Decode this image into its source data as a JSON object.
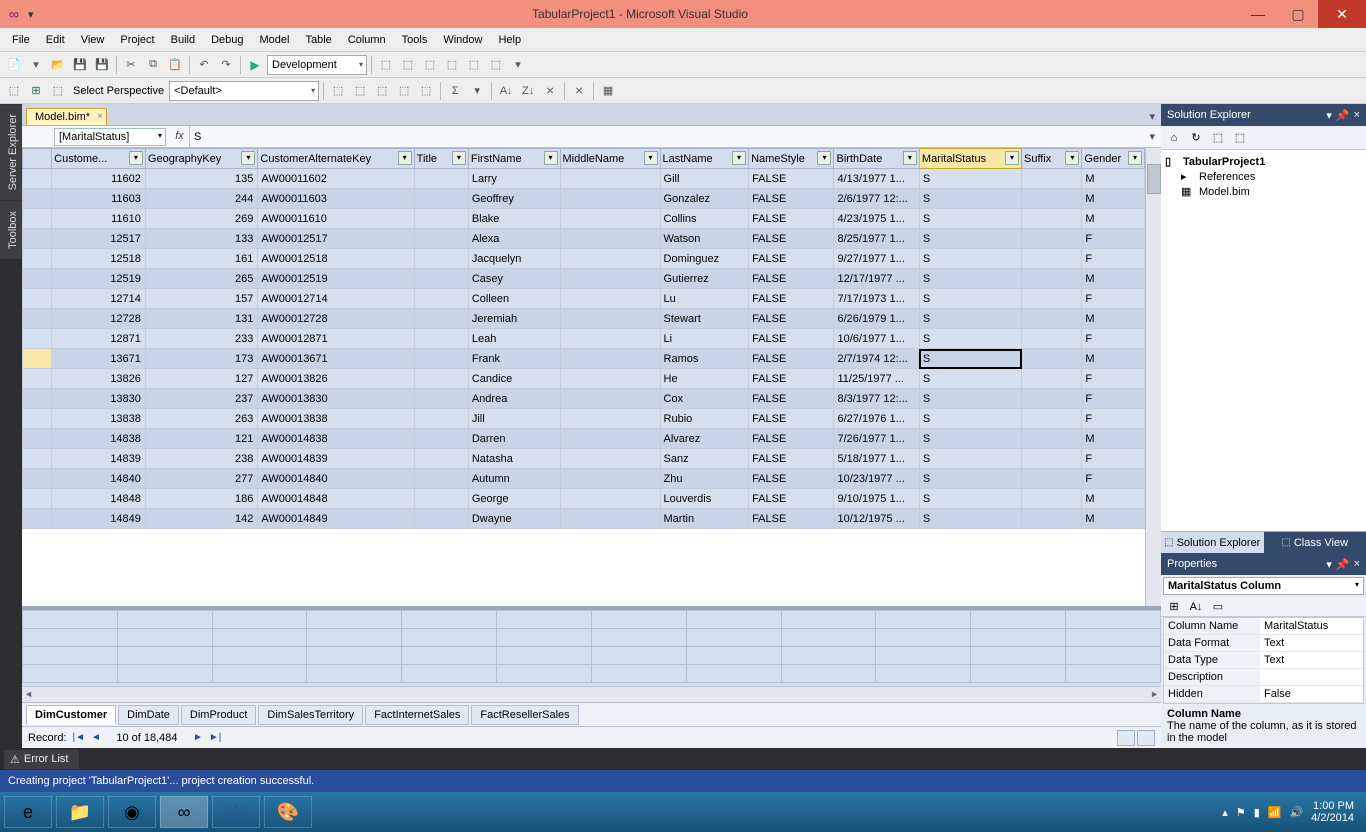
{
  "window": {
    "title": "TabularProject1 - Microsoft Visual Studio"
  },
  "menu": [
    "File",
    "Edit",
    "View",
    "Project",
    "Build",
    "Debug",
    "Model",
    "Table",
    "Column",
    "Tools",
    "Window",
    "Help"
  ],
  "toolbar": {
    "config": "Development",
    "perspective_label": "Select Perspective",
    "perspective_value": "<Default>"
  },
  "tab": {
    "name": "Model.bim*"
  },
  "formula": {
    "name_box": "[MaritalStatus]",
    "value": "S"
  },
  "columns": [
    "Custome...",
    "GeographyKey",
    "CustomerAlternateKey",
    "Title",
    "FirstName",
    "MiddleName",
    "LastName",
    "NameStyle",
    "BirthDate",
    "MaritalStatus",
    "Suffix",
    "Gender"
  ],
  "rows": [
    {
      "ck": 11602,
      "gk": 135,
      "alt": "AW00011602",
      "fn": "Larry",
      "ln": "Gill",
      "ns": "FALSE",
      "bd": "4/13/1977 1...",
      "ms": "S",
      "g": "M"
    },
    {
      "ck": 11603,
      "gk": 244,
      "alt": "AW00011603",
      "fn": "Geoffrey",
      "ln": "Gonzalez",
      "ns": "FALSE",
      "bd": "2/6/1977 12:...",
      "ms": "S",
      "g": "M"
    },
    {
      "ck": 11610,
      "gk": 269,
      "alt": "AW00011610",
      "fn": "Blake",
      "ln": "Collins",
      "ns": "FALSE",
      "bd": "4/23/1975 1...",
      "ms": "S",
      "g": "M"
    },
    {
      "ck": 12517,
      "gk": 133,
      "alt": "AW00012517",
      "fn": "Alexa",
      "ln": "Watson",
      "ns": "FALSE",
      "bd": "8/25/1977 1...",
      "ms": "S",
      "g": "F"
    },
    {
      "ck": 12518,
      "gk": 161,
      "alt": "AW00012518",
      "fn": "Jacquelyn",
      "ln": "Dominguez",
      "ns": "FALSE",
      "bd": "9/27/1977 1...",
      "ms": "S",
      "g": "F"
    },
    {
      "ck": 12519,
      "gk": 265,
      "alt": "AW00012519",
      "fn": "Casey",
      "ln": "Gutierrez",
      "ns": "FALSE",
      "bd": "12/17/1977 ...",
      "ms": "S",
      "g": "M"
    },
    {
      "ck": 12714,
      "gk": 157,
      "alt": "AW00012714",
      "fn": "Colleen",
      "ln": "Lu",
      "ns": "FALSE",
      "bd": "7/17/1973 1...",
      "ms": "S",
      "g": "F"
    },
    {
      "ck": 12728,
      "gk": 131,
      "alt": "AW00012728",
      "fn": "Jeremiah",
      "ln": "Stewart",
      "ns": "FALSE",
      "bd": "6/26/1979 1...",
      "ms": "S",
      "g": "M"
    },
    {
      "ck": 12871,
      "gk": 233,
      "alt": "AW00012871",
      "fn": "Leah",
      "ln": "Li",
      "ns": "FALSE",
      "bd": "10/6/1977 1...",
      "ms": "S",
      "g": "F"
    },
    {
      "ck": 13671,
      "gk": 173,
      "alt": "AW00013671",
      "fn": "Frank",
      "ln": "Ramos",
      "ns": "FALSE",
      "bd": "2/7/1974 12:...",
      "ms": "S",
      "g": "M",
      "sel": true
    },
    {
      "ck": 13826,
      "gk": 127,
      "alt": "AW00013826",
      "fn": "Candice",
      "ln": "He",
      "ns": "FALSE",
      "bd": "11/25/1977 ...",
      "ms": "S",
      "g": "F"
    },
    {
      "ck": 13830,
      "gk": 237,
      "alt": "AW00013830",
      "fn": "Andrea",
      "ln": "Cox",
      "ns": "FALSE",
      "bd": "8/3/1977 12:...",
      "ms": "S",
      "g": "F"
    },
    {
      "ck": 13838,
      "gk": 263,
      "alt": "AW00013838",
      "fn": "Jill",
      "ln": "Rubio",
      "ns": "FALSE",
      "bd": "6/27/1976 1...",
      "ms": "S",
      "g": "F"
    },
    {
      "ck": 14838,
      "gk": 121,
      "alt": "AW00014838",
      "fn": "Darren",
      "ln": "Alvarez",
      "ns": "FALSE",
      "bd": "7/26/1977 1...",
      "ms": "S",
      "g": "M"
    },
    {
      "ck": 14839,
      "gk": 238,
      "alt": "AW00014839",
      "fn": "Natasha",
      "ln": "Sanz",
      "ns": "FALSE",
      "bd": "5/18/1977 1...",
      "ms": "S",
      "g": "F"
    },
    {
      "ck": 14840,
      "gk": 277,
      "alt": "AW00014840",
      "fn": "Autumn",
      "ln": "Zhu",
      "ns": "FALSE",
      "bd": "10/23/1977 ...",
      "ms": "S",
      "g": "F"
    },
    {
      "ck": 14848,
      "gk": 186,
      "alt": "AW00014848",
      "fn": "George",
      "ln": "Louverdis",
      "ns": "FALSE",
      "bd": "9/10/1975 1...",
      "ms": "S",
      "g": "M"
    },
    {
      "ck": 14849,
      "gk": 142,
      "alt": "AW00014849",
      "fn": "Dwayne",
      "ln": "Martin",
      "ns": "FALSE",
      "bd": "10/12/1975 ...",
      "ms": "S",
      "g": "M"
    }
  ],
  "sheets": [
    "DimCustomer",
    "DimDate",
    "DimProduct",
    "DimSalesTerritory",
    "FactInternetSales",
    "FactResellerSales"
  ],
  "record": {
    "label": "Record:",
    "pos": "10 of 18,484"
  },
  "solution": {
    "title": "Solution Explorer",
    "project": "TabularProject1",
    "ref": "References",
    "model": "Model.bim",
    "tabs": [
      "Solution Explorer",
      "Class View"
    ]
  },
  "properties": {
    "title": "Properties",
    "object": "MaritalStatus Column",
    "rows": [
      {
        "n": "Column Name",
        "v": "MaritalStatus"
      },
      {
        "n": "Data Format",
        "v": "Text"
      },
      {
        "n": "Data Type",
        "v": "Text"
      },
      {
        "n": "Description",
        "v": ""
      },
      {
        "n": "Hidden",
        "v": "False"
      }
    ],
    "desc_title": "Column Name",
    "desc": "The name of the column, as it is stored in the model"
  },
  "error_tab": "Error List",
  "status": "Creating project 'TabularProject1'... project creation successful.",
  "clock": {
    "time": "1:00 PM",
    "date": "4/2/2014"
  }
}
